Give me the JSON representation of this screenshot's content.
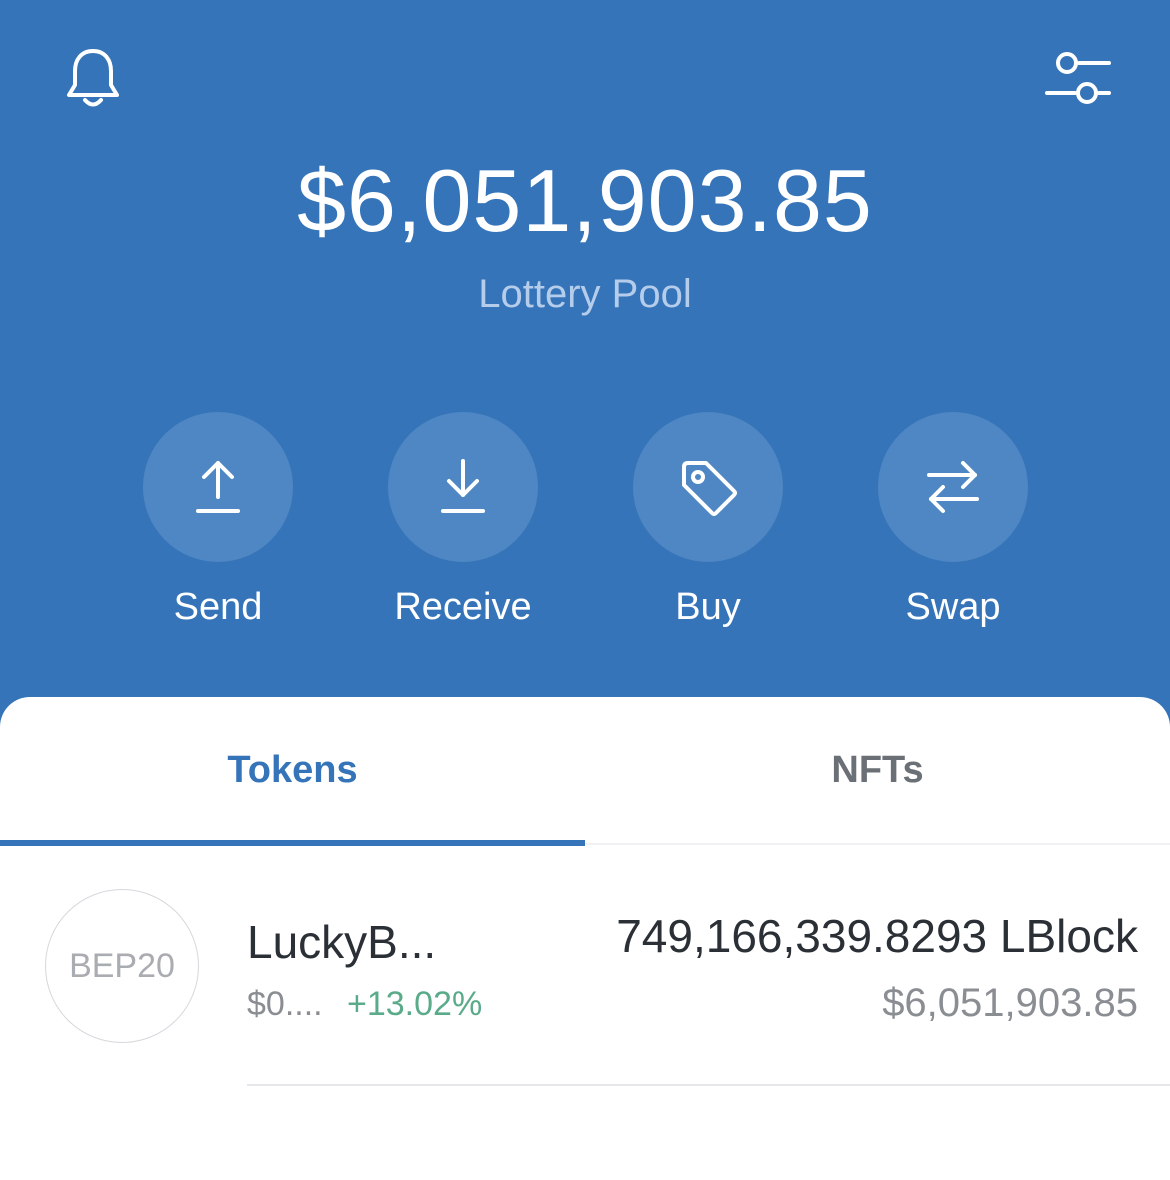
{
  "header": {
    "balance": "$6,051,903.85",
    "subtitle": "Lottery Pool",
    "icons": [
      "bell-icon",
      "sliders-icon"
    ],
    "colors": {
      "background": "#3574b9",
      "circle": "#4f87c4"
    }
  },
  "actions": [
    {
      "label": "Send",
      "icon": "arrow-up-icon"
    },
    {
      "label": "Receive",
      "icon": "arrow-down-icon"
    },
    {
      "label": "Buy",
      "icon": "tag-icon"
    },
    {
      "label": "Swap",
      "icon": "swap-icon"
    }
  ],
  "tabs": [
    {
      "label": "Tokens",
      "active": true
    },
    {
      "label": "NFTs",
      "active": false
    }
  ],
  "tokens": [
    {
      "logo_text": "BEP20",
      "name": "LuckyB...",
      "price": "$0....",
      "change": "+13.02%",
      "amount": "749,166,339.8293 LBlock",
      "value": "$6,051,903.85"
    }
  ],
  "colors": {
    "accent": "#3574b9",
    "positive": "#5aab8a"
  }
}
